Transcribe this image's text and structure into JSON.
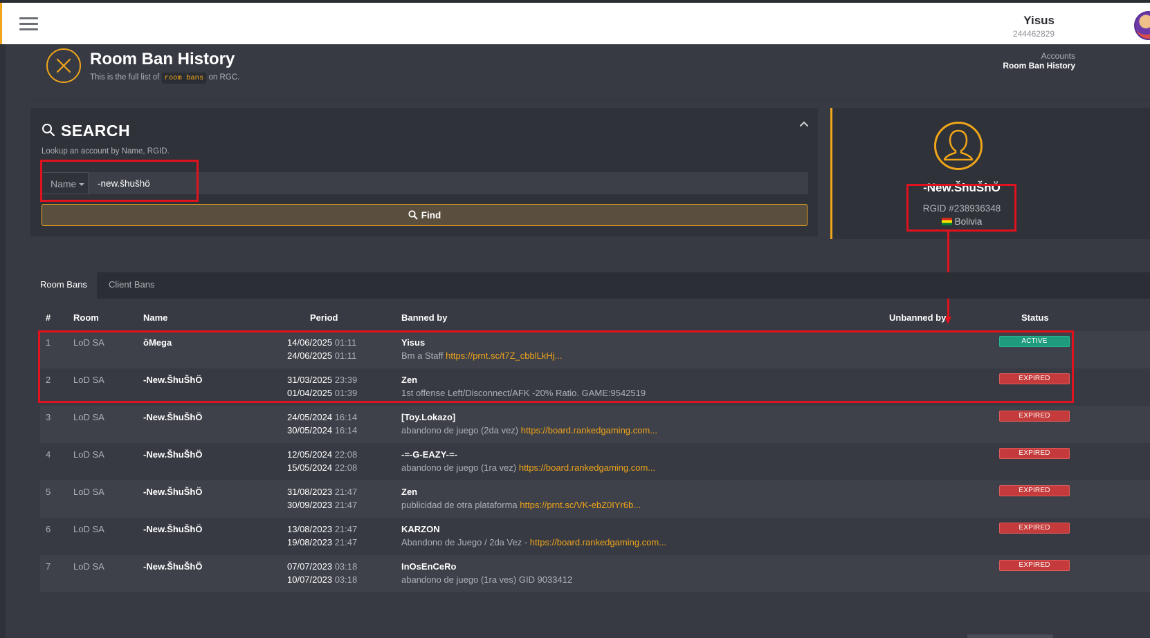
{
  "user": {
    "name": "Yisus",
    "id": "244462829"
  },
  "header": {
    "title": "Room Ban History",
    "subtitle_before": "This is the full list of",
    "subtitle_code": "room bans",
    "subtitle_after": "on RGC."
  },
  "breadcrumb": [
    "Accounts",
    "Room Ban History"
  ],
  "search": {
    "title": "SEARCH",
    "description": "Lookup an account by Name, RGID.",
    "type_label": "Name",
    "value": "-new.šhušhö",
    "find_label": "Find"
  },
  "profile": {
    "name": "-New.ŠhuŠhÖ",
    "rgid": "RGID #238936348",
    "country": "Bolivia"
  },
  "tabs": [
    "Room Bans",
    "Client Bans"
  ],
  "table": {
    "headers": {
      "num": "#",
      "room": "Room",
      "name": "Name",
      "period": "Period",
      "banned_by": "Banned by",
      "unbanned_by": "Unbanned by",
      "status": "Status"
    },
    "rows": [
      {
        "num": "1",
        "room": "LoD SA",
        "name": "ǒMega",
        "start_date": "14/06/2025",
        "start_time": "01:11",
        "end_date": "24/06/2025",
        "end_time": "01:11",
        "banned_by": "Yisus",
        "reason": "Bm a Staff",
        "link": "https://prnt.sc/t7Z_cbblLkHj...",
        "status": "ACTIVE"
      },
      {
        "num": "2",
        "room": "LoD SA",
        "name": "-New.ŠhuŠhÖ",
        "start_date": "31/03/2025",
        "start_time": "23:39",
        "end_date": "01/04/2025",
        "end_time": "01:39",
        "banned_by": "Zen",
        "reason": "1st offense Left/Disconnect/AFK -20% Ratio. GAME:9542519",
        "link": "",
        "status": "EXPIRED"
      },
      {
        "num": "3",
        "room": "LoD SA",
        "name": "-New.ŠhuŠhÖ",
        "start_date": "24/05/2024",
        "start_time": "16:14",
        "end_date": "30/05/2024",
        "end_time": "16:14",
        "banned_by": "[Toy.Lokazo]",
        "reason": "abandono de juego (2da vez)",
        "link": "https://board.rankedgaming.com...",
        "status": "EXPIRED"
      },
      {
        "num": "4",
        "room": "LoD SA",
        "name": "-New.ŠhuŠhÖ",
        "start_date": "12/05/2024",
        "start_time": "22:08",
        "end_date": "15/05/2024",
        "end_time": "22:08",
        "banned_by": "-=-G-EAZY-=-",
        "reason": "abandono de juego (1ra vez)",
        "link": "https://board.rankedgaming.com...",
        "status": "EXPIRED"
      },
      {
        "num": "5",
        "room": "LoD SA",
        "name": "-New.ŠhuŠhÖ",
        "start_date": "31/08/2023",
        "start_time": "21:47",
        "end_date": "30/09/2023",
        "end_time": "21:47",
        "banned_by": "Zen",
        "reason": "publicidad de otra plataforma",
        "link": "https://prnt.sc/VK-ebZ0IYr6b...",
        "status": "EXPIRED"
      },
      {
        "num": "6",
        "room": "LoD SA",
        "name": "-New.ŠhuŠhÖ",
        "start_date": "13/08/2023",
        "start_time": "21:47",
        "end_date": "19/08/2023",
        "end_time": "21:47",
        "banned_by": "KARZON",
        "reason": "Abandono de Juego / 2da Vez -",
        "link": "https://board.rankedgaming.com...",
        "status": "EXPIRED"
      },
      {
        "num": "7",
        "room": "LoD SA",
        "name": "-New.ŠhuŠhÖ",
        "start_date": "07/07/2023",
        "start_time": "03:18",
        "end_date": "10/07/2023",
        "end_time": "03:18",
        "banned_by": "InOsEnCeRo",
        "reason": "abandono de juego (1ra ves) GID 9033412",
        "link": "",
        "status": "EXPIRED"
      }
    ]
  },
  "icons": {
    "menu": "hamburger-icon",
    "header": "close-circle-icon",
    "search": "search-icon",
    "collapse": "chevron-up-icon",
    "profile": "user-icon",
    "flag": "bolivia-flag-icon"
  },
  "colors": {
    "accent": "#f0a51a",
    "active": "#1e9b7c",
    "expired": "#c53a3a",
    "annotation": "#e0121d"
  }
}
